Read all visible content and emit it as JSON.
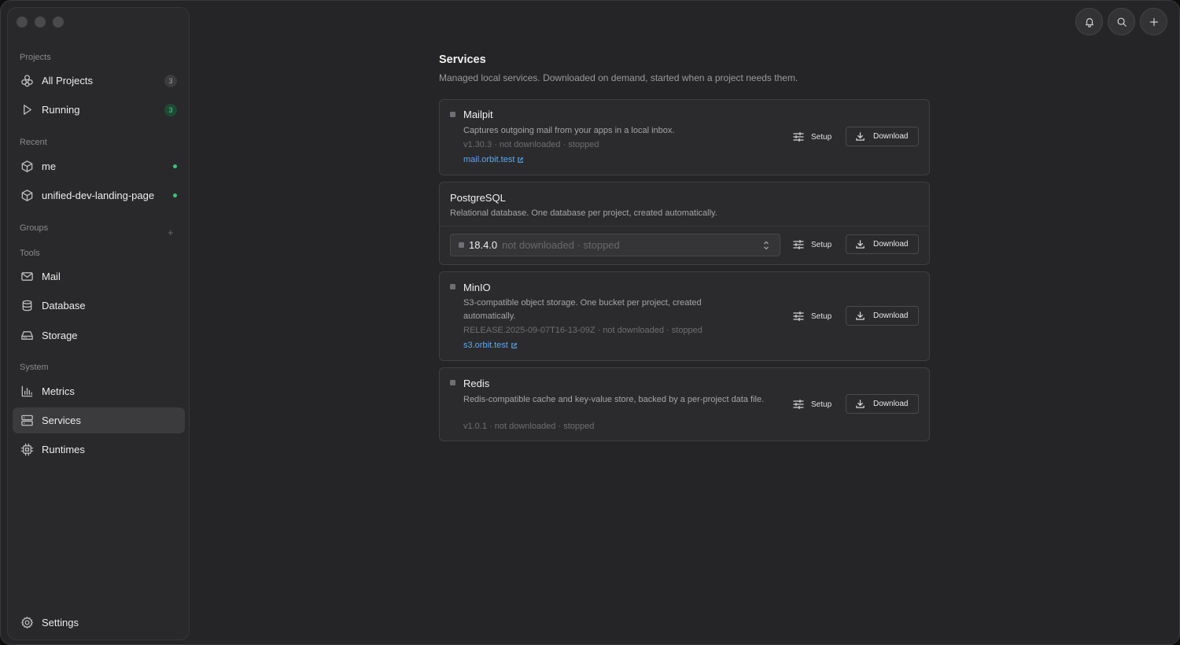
{
  "sidebar": {
    "sections": {
      "projects": "Projects",
      "recent": "Recent",
      "groups": "Groups",
      "tools": "Tools",
      "system": "System"
    },
    "projects": [
      {
        "label": "All Projects",
        "count": "3"
      },
      {
        "label": "Running",
        "count": "3"
      }
    ],
    "recent": [
      {
        "label": "me"
      },
      {
        "label": "unified-dev-landing-page"
      }
    ],
    "tools": [
      {
        "label": "Mail"
      },
      {
        "label": "Database"
      },
      {
        "label": "Storage"
      }
    ],
    "system": [
      {
        "label": "Metrics"
      },
      {
        "label": "Services"
      },
      {
        "label": "Runtimes"
      }
    ],
    "settings": "Settings",
    "groups_add": "+"
  },
  "page": {
    "title": "Services",
    "subtitle": "Managed local services. Downloaded on demand, started when a project needs them."
  },
  "buttons": {
    "setup": "Setup",
    "download": "Download"
  },
  "services": [
    {
      "name": "Mailpit",
      "description": "Captures outgoing mail from your apps in a local inbox.",
      "meta": "v1.30.3 · not downloaded · stopped",
      "link": "mail.orbit.test"
    },
    {
      "name": "PostgreSQL",
      "description": "Relational database. One database per project, created automatically.",
      "version": "18.4.0",
      "status": "not downloaded · stopped"
    },
    {
      "name": "MinIO",
      "description": "S3-compatible object storage. One bucket per project, created automatically.",
      "meta": "RELEASE.2025-09-07T16-13-09Z · not downloaded · stopped",
      "link": "s3.orbit.test"
    },
    {
      "name": "Redis",
      "description": "Redis-compatible cache and key-value store, backed by a per-project data file.",
      "meta": "v1.0.1 · not downloaded · stopped"
    }
  ],
  "colors": {
    "accent_link": "#5aa8f0",
    "running_green": "#34c77b",
    "window_bg": "#252527",
    "sidebar_bg": "#29292b"
  }
}
